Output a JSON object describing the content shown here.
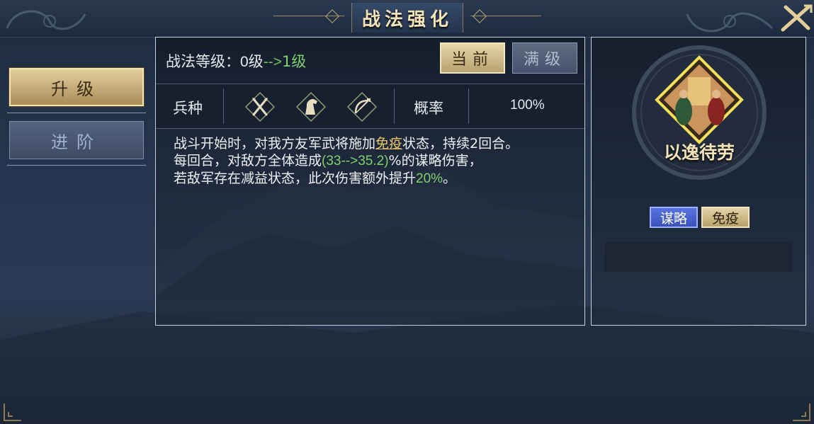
{
  "title": "战法强化",
  "tabs": [
    {
      "label": "升级",
      "active": true
    },
    {
      "label": "进阶",
      "active": false
    }
  ],
  "level": {
    "label": "战法等级：",
    "current": "0级",
    "arrow": "-->",
    "next": "1级"
  },
  "buttons": {
    "current": "当前",
    "max": "满级"
  },
  "troop": {
    "label": "兵种",
    "icons": [
      "spear-icon",
      "cavalry-icon",
      "archer-icon"
    ],
    "rate_label": "概率",
    "rate_value": "100%"
  },
  "description": {
    "line1_a": "战斗开始时，对我方友军武将施加",
    "line1_kw": "免疫",
    "line1_b": "状态，持续2回合。",
    "line2_a": "每回合，对敌方全体造成",
    "line2_g": "(33-->35.2)",
    "line2_b": "%的谋略伤害，",
    "line3_a": "若敌军存在减益状态，此次伤害额外提升",
    "line3_g": "20%",
    "line3_b": "。"
  },
  "skill": {
    "name": "以逸待劳",
    "tags": [
      "谋略",
      "免疫"
    ]
  },
  "colors": {
    "gold": "#e3cf9c",
    "green": "#7fd06f",
    "tag_blue": "#4a64d0"
  }
}
